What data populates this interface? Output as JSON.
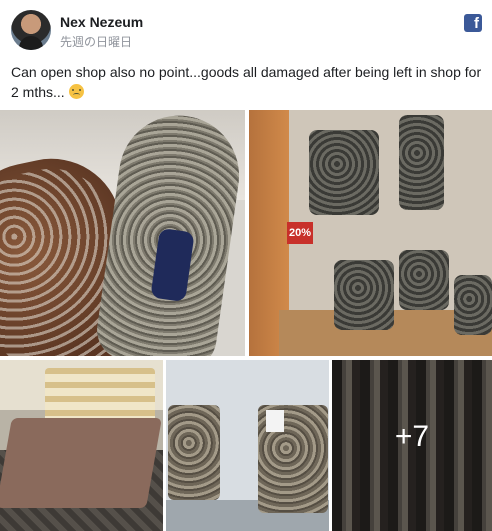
{
  "post": {
    "author": "Nex Nezeum",
    "timestamp": "先週の日曜日",
    "platform_icon": "facebook-icon",
    "caption": "Can open shop also no point...goods all damaged after being left in shop for 2 mths...",
    "caption_emoji": "worried-face-emoji"
  },
  "photos": {
    "price_tag": "20%",
    "more_count": "+7"
  },
  "colors": {
    "facebook_blue": "#3b5998",
    "author_text": "#1c1e21",
    "meta_text": "#90949c"
  }
}
